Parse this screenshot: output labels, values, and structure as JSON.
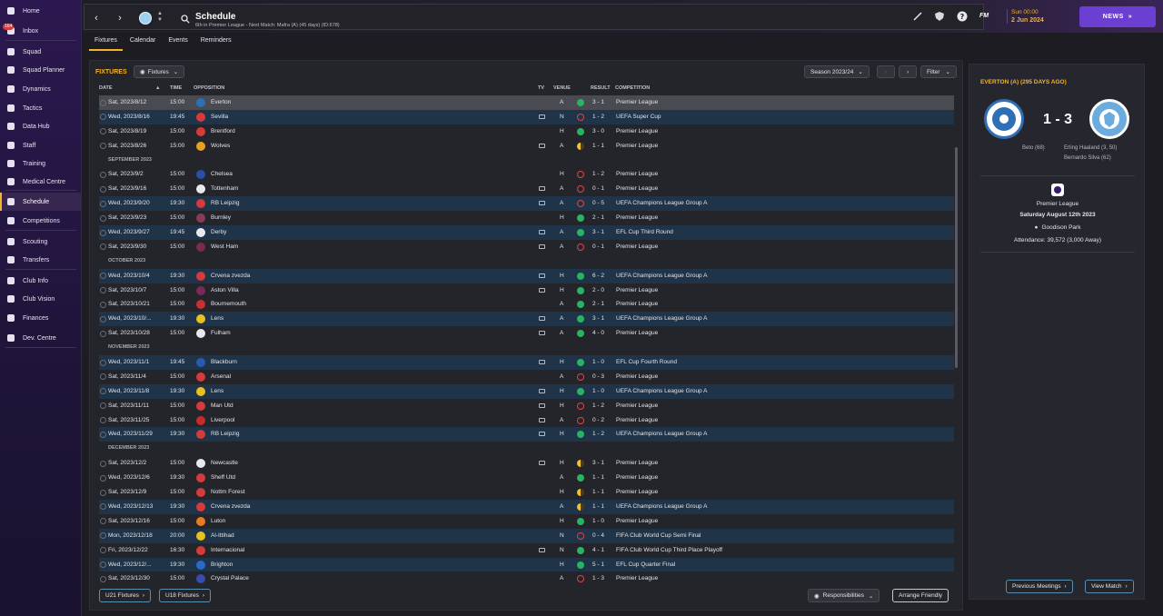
{
  "sidebar": {
    "items": [
      {
        "label": "Home",
        "icon": "home-icon"
      },
      {
        "label": "Inbox",
        "icon": "inbox-icon",
        "badge": "164"
      },
      {
        "label": "Squad",
        "icon": "squad-icon"
      },
      {
        "label": "Squad Planner",
        "icon": "clipboard-icon"
      },
      {
        "label": "Dynamics",
        "icon": "dynamics-icon"
      },
      {
        "label": "Tactics",
        "icon": "tactics-icon"
      },
      {
        "label": "Data Hub",
        "icon": "data-hub-icon"
      },
      {
        "label": "Staff",
        "icon": "staff-icon"
      },
      {
        "label": "Training",
        "icon": "training-icon"
      },
      {
        "label": "Medical Centre",
        "icon": "medical-icon"
      },
      {
        "label": "Schedule",
        "icon": "calendar-icon",
        "active": true
      },
      {
        "label": "Competitions",
        "icon": "trophy-icon"
      },
      {
        "label": "Scouting",
        "icon": "search-icon"
      },
      {
        "label": "Transfers",
        "icon": "transfers-icon"
      },
      {
        "label": "Club Info",
        "icon": "shield-icon"
      },
      {
        "label": "Club Vision",
        "icon": "vision-icon"
      },
      {
        "label": "Finances",
        "icon": "finances-icon"
      },
      {
        "label": "Dev. Centre",
        "icon": "dev-centre-icon"
      }
    ]
  },
  "header": {
    "title": "Schedule",
    "subtitle": "6th in Premier League - Next Match: Mafra (A) (45 days) (ID:678)",
    "fm_label": "FM",
    "time": "Sun 00:00",
    "date": "2 Jun 2024",
    "news_label": "NEWS"
  },
  "tabs": [
    "Fixtures",
    "Calendar",
    "Events",
    "Reminders"
  ],
  "fixtures": {
    "title": "FIXTURES",
    "view_label": "Fixtures",
    "season_label": "Season 2023/24",
    "filter_label": "Filter",
    "columns": {
      "date": "DATE",
      "time": "TIME",
      "opposition": "OPPOSITION",
      "tv": "TV",
      "venue": "VENUE",
      "result": "RESULT",
      "competition": "COMPETITION"
    },
    "rows": [
      {
        "date": "Sat, 2023/8/12",
        "time": "15:00",
        "opp": "Everton",
        "crest": "#2e6fb6",
        "tv": false,
        "venue": "A",
        "r": "win",
        "score": "3 - 1",
        "comp": "Premier League",
        "style": "sel"
      },
      {
        "date": "Wed, 2023/8/16",
        "time": "19:45",
        "opp": "Sevilla",
        "crest": "#d63a3a",
        "tv": true,
        "venue": "N",
        "r": "loss",
        "score": "1 - 2",
        "comp": "UEFA Super Cup",
        "style": "alt"
      },
      {
        "date": "Sat, 2023/8/19",
        "time": "15:00",
        "opp": "Brentford",
        "crest": "#d63a3a",
        "tv": false,
        "venue": "H",
        "r": "win",
        "score": "3 - 0",
        "comp": "Premier League",
        "style": ""
      },
      {
        "date": "Sat, 2023/8/26",
        "time": "15:00",
        "opp": "Wolves",
        "crest": "#e8a020",
        "tv": true,
        "venue": "A",
        "r": "draw",
        "score": "1 - 1",
        "comp": "Premier League",
        "style": ""
      },
      {
        "month": "SEPTEMBER 2023"
      },
      {
        "date": "Sat, 2023/9/2",
        "time": "15:00",
        "opp": "Chelsea",
        "crest": "#2a4fa8",
        "tv": false,
        "venue": "H",
        "r": "loss",
        "score": "1 - 2",
        "comp": "Premier League",
        "style": ""
      },
      {
        "date": "Sat, 2023/9/16",
        "time": "15:00",
        "opp": "Tottenham",
        "crest": "#e8e8ee",
        "tv": true,
        "venue": "A",
        "r": "loss",
        "score": "0 - 1",
        "comp": "Premier League",
        "style": ""
      },
      {
        "date": "Wed, 2023/9/20",
        "time": "19:30",
        "opp": "RB Leipzig",
        "crest": "#d63a3a",
        "tv": true,
        "venue": "A",
        "r": "loss",
        "score": "0 - 5",
        "comp": "UEFA Champions League Group A",
        "style": "alt"
      },
      {
        "date": "Sat, 2023/9/23",
        "time": "15:00",
        "opp": "Burnley",
        "crest": "#8a3a5a",
        "tv": false,
        "venue": "H",
        "r": "win",
        "score": "2 - 1",
        "comp": "Premier League",
        "style": ""
      },
      {
        "date": "Wed, 2023/9/27",
        "time": "19:45",
        "opp": "Derby",
        "crest": "#e8e8ee",
        "tv": true,
        "venue": "A",
        "r": "win",
        "score": "3 - 1",
        "comp": "EFL Cup Third Round",
        "style": "alt"
      },
      {
        "date": "Sat, 2023/9/30",
        "time": "15:00",
        "opp": "West Ham",
        "crest": "#7a2a4a",
        "tv": true,
        "venue": "A",
        "r": "loss",
        "score": "0 - 1",
        "comp": "Premier League",
        "style": ""
      },
      {
        "month": "OCTOBER 2023"
      },
      {
        "date": "Wed, 2023/10/4",
        "time": "19:30",
        "opp": "Crvena zvezda",
        "crest": "#d63a3a",
        "tv": true,
        "venue": "H",
        "r": "win",
        "score": "6 - 2",
        "comp": "UEFA Champions League Group A",
        "style": "alt"
      },
      {
        "date": "Sat, 2023/10/7",
        "time": "15:00",
        "opp": "Aston Villa",
        "crest": "#7a2a5a",
        "tv": true,
        "venue": "H",
        "r": "win",
        "score": "2 - 0",
        "comp": "Premier League",
        "style": ""
      },
      {
        "date": "Sat, 2023/10/21",
        "time": "15:00",
        "opp": "Bournemouth",
        "crest": "#c83030",
        "tv": false,
        "venue": "A",
        "r": "win",
        "score": "2 - 1",
        "comp": "Premier League",
        "style": ""
      },
      {
        "date": "Wed, 2023/10/...",
        "time": "19:30",
        "opp": "Lens",
        "crest": "#e8c020",
        "tv": true,
        "venue": "A",
        "r": "win",
        "score": "3 - 1",
        "comp": "UEFA Champions League Group A",
        "style": "alt"
      },
      {
        "date": "Sat, 2023/10/28",
        "time": "15:00",
        "opp": "Fulham",
        "crest": "#e8e8ee",
        "tv": true,
        "venue": "A",
        "r": "win",
        "score": "4 - 0",
        "comp": "Premier League",
        "style": ""
      },
      {
        "month": "NOVEMBER 2023"
      },
      {
        "date": "Wed, 2023/11/1",
        "time": "19:45",
        "opp": "Blackburn",
        "crest": "#2a5ab0",
        "tv": true,
        "venue": "H",
        "r": "win",
        "score": "1 - 0",
        "comp": "EFL Cup Fourth Round",
        "style": "alt"
      },
      {
        "date": "Sat, 2023/11/4",
        "time": "15:00",
        "opp": "Arsenal",
        "crest": "#d63a3a",
        "tv": false,
        "venue": "A",
        "r": "loss",
        "score": "0 - 3",
        "comp": "Premier League",
        "style": ""
      },
      {
        "date": "Wed, 2023/11/8",
        "time": "19:30",
        "opp": "Lens",
        "crest": "#e8c020",
        "tv": true,
        "venue": "H",
        "r": "win",
        "score": "1 - 0",
        "comp": "UEFA Champions League Group A",
        "style": "alt"
      },
      {
        "date": "Sat, 2023/11/11",
        "time": "15:00",
        "opp": "Man Utd",
        "crest": "#d63a3a",
        "tv": true,
        "venue": "H",
        "r": "loss",
        "score": "1 - 2",
        "comp": "Premier League",
        "style": ""
      },
      {
        "date": "Sat, 2023/11/25",
        "time": "15:00",
        "opp": "Liverpool",
        "crest": "#c82a2a",
        "tv": true,
        "venue": "A",
        "r": "loss",
        "score": "0 - 2",
        "comp": "Premier League",
        "style": ""
      },
      {
        "date": "Wed, 2023/11/29",
        "time": "19:30",
        "opp": "RB Leipzig",
        "crest": "#d63a3a",
        "tv": true,
        "venue": "H",
        "r": "win",
        "score": "1 - 2",
        "comp": "UEFA Champions League Group A",
        "style": "alt"
      },
      {
        "month": "DECEMBER 2023"
      },
      {
        "date": "Sat, 2023/12/2",
        "time": "15:00",
        "opp": "Newcastle",
        "crest": "#e8e8ee",
        "tv": true,
        "venue": "H",
        "r": "draw",
        "score": "3 - 1",
        "comp": "Premier League",
        "style": ""
      },
      {
        "date": "Wed, 2023/12/6",
        "time": "19:30",
        "opp": "Sheff Utd",
        "crest": "#d63a3a",
        "tv": false,
        "venue": "A",
        "r": "win",
        "score": "1 - 1",
        "comp": "Premier League",
        "style": ""
      },
      {
        "date": "Sat, 2023/12/9",
        "time": "15:00",
        "opp": "Nottm Forest",
        "crest": "#d63a3a",
        "tv": false,
        "venue": "H",
        "r": "draw",
        "score": "1 - 1",
        "comp": "Premier League",
        "style": ""
      },
      {
        "date": "Wed, 2023/12/13",
        "time": "19:30",
        "opp": "Crvena zvezda",
        "crest": "#d63a3a",
        "tv": false,
        "venue": "A",
        "r": "draw",
        "score": "1 - 1",
        "comp": "UEFA Champions League Group A",
        "style": "alt"
      },
      {
        "date": "Sat, 2023/12/16",
        "time": "15:00",
        "opp": "Luton",
        "crest": "#e87a20",
        "tv": false,
        "venue": "H",
        "r": "win",
        "score": "1 - 0",
        "comp": "Premier League",
        "style": ""
      },
      {
        "date": "Mon, 2023/12/18",
        "time": "20:00",
        "opp": "Al-Ittihad",
        "crest": "#e8c020",
        "tv": false,
        "venue": "N",
        "r": "loss",
        "score": "0 - 4",
        "comp": "FIFA Club World Cup Semi Final",
        "style": "alt"
      },
      {
        "date": "Fri, 2023/12/22",
        "time": "16:30",
        "opp": "Internacional",
        "crest": "#d63a3a",
        "tv": true,
        "venue": "N",
        "r": "win",
        "score": "4 - 1",
        "comp": "FIFA Club World Cup Third Place Playoff",
        "style": ""
      },
      {
        "date": "Wed, 2023/12/...",
        "time": "19:30",
        "opp": "Brighton",
        "crest": "#2a6ac8",
        "tv": false,
        "venue": "H",
        "r": "win",
        "score": "5 - 1",
        "comp": "EFL Cup Quarter Final",
        "style": "alt"
      },
      {
        "date": "Sat, 2023/12/30",
        "time": "15:00",
        "opp": "Crystal Palace",
        "crest": "#3a4ab0",
        "tv": false,
        "venue": "A",
        "r": "loss",
        "score": "1 - 3",
        "comp": "Premier League",
        "style": ""
      }
    ],
    "u21_label": "U21 Fixtures",
    "u18_label": "U18 Fixtures",
    "responsibilities_label": "Responsibilities",
    "arrange_label": "Arrange Friendly"
  },
  "match": {
    "title": "EVERTON (A) (295 DAYS AGO)",
    "score": "1 - 3",
    "home_scorer": "Beto (68)",
    "away_scorers": [
      "Erling Haaland (3, 50)",
      "Bernardo Silva (62)"
    ],
    "competition": "Premier League",
    "date": "Saturday August 12th 2023",
    "stadium": "Goodison Park",
    "attendance": "Attendance: 39,572 (3,000 Away)",
    "prev_label": "Previous Meetings",
    "view_label": "View Match"
  },
  "colors": {
    "accent": "#f3b32a",
    "win": "#28b463",
    "loss": "#e24545",
    "news": "#6a3fd1",
    "alt_row": "#1f3448"
  }
}
